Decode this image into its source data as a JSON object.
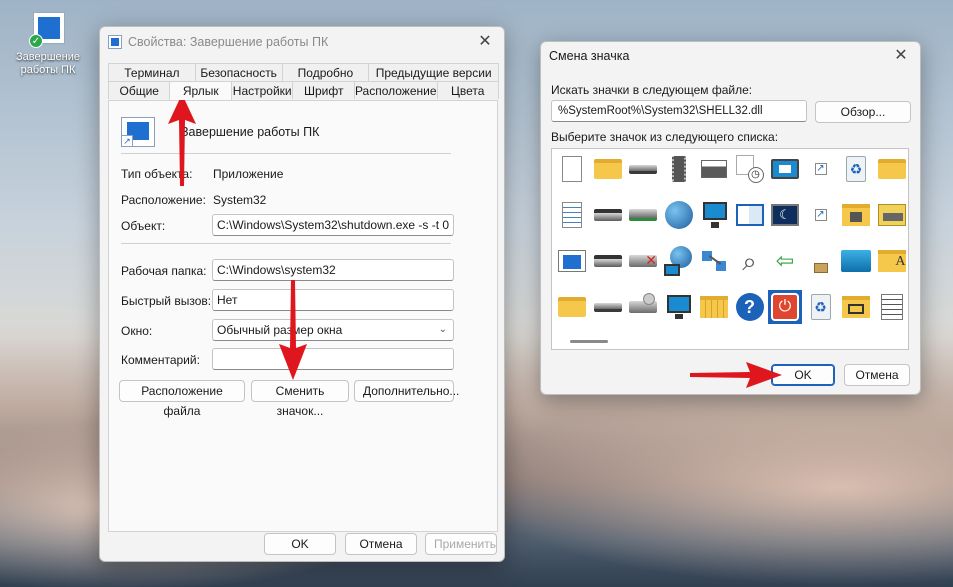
{
  "desktop": {
    "shortcut_label": "Завершение работы ПК"
  },
  "props_dialog": {
    "title": "Свойства: Завершение работы ПК",
    "tabs_row1": [
      "Терминал",
      "Безопасность",
      "Подробно",
      "Предыдущие версии"
    ],
    "tabs_row2": [
      "Общие",
      "Ярлык",
      "Настройки",
      "Шрифт",
      "Расположение",
      "Цвета"
    ],
    "active_tab": "Ярлык",
    "shortcut_name": "Завершение работы ПК",
    "type_label": "Тип объекта:",
    "type_value": "Приложение",
    "location_label": "Расположение:",
    "location_value": "System32",
    "target_label": "Объект:",
    "target_value": "C:\\Windows\\System32\\shutdown.exe -s -t 0",
    "workdir_label": "Рабочая папка:",
    "workdir_value": "C:\\Windows\\system32",
    "hotkey_label": "Быстрый вызов:",
    "hotkey_value": "Нет",
    "window_label": "Окно:",
    "window_value": "Обычный размер окна",
    "comment_label": "Комментарий:",
    "comment_value": "",
    "btn_open_location": "Расположение файла",
    "btn_change_icon": "Сменить значок...",
    "btn_advanced": "Дополнительно...",
    "btn_ok": "OK",
    "btn_cancel": "Отмена",
    "btn_apply": "Применить"
  },
  "change_icon_dialog": {
    "title": "Смена значка",
    "search_label": "Искать значки в следующем файле:",
    "path_value": "%SystemRoot%\\System32\\SHELL32.dll",
    "browse_button": "Обзор...",
    "list_label": "Выберите значок из следующего списка:",
    "icons": [
      [
        "document-icon",
        "folder-icon",
        "drive-icon",
        "memory-chip-icon",
        "printer-icon",
        "clock-icon",
        "monitor-window-icon",
        "shortcut-arrow-icon",
        "recycle-bin-icon",
        "folder-icon"
      ],
      [
        "text-document-icon",
        "floppy-drive-icon",
        "network-drive-icon",
        "globe-icon",
        "network-monitor-icon",
        "control-panel-icon",
        "moon-screen-icon",
        "shortcut-arrow-icon",
        "folder-lock-icon",
        "folder-drive-icon"
      ],
      [
        "window-app-icon",
        "floppy-drive-icon",
        "drive-error-icon",
        "globe-network-icon",
        "network-cable-icon",
        "search-icon",
        "install-arrow-icon",
        "empty-icon",
        "blue-tile-icon",
        "font-folder-icon"
      ],
      [
        "folder-icon",
        "drive-icon",
        "cd-drive-icon",
        "monitor-icon",
        "folder-grid-icon",
        "help-icon",
        "power-icon",
        "recycle-bin-icon",
        "folder-network-icon",
        "list-window-icon"
      ]
    ],
    "selected_icon": "power-icon",
    "btn_ok": "OK",
    "btn_cancel": "Отмена"
  },
  "colors": {
    "accent": "#1c62b9",
    "arrow_red": "#e0161f",
    "power_red": "#e0462f"
  }
}
